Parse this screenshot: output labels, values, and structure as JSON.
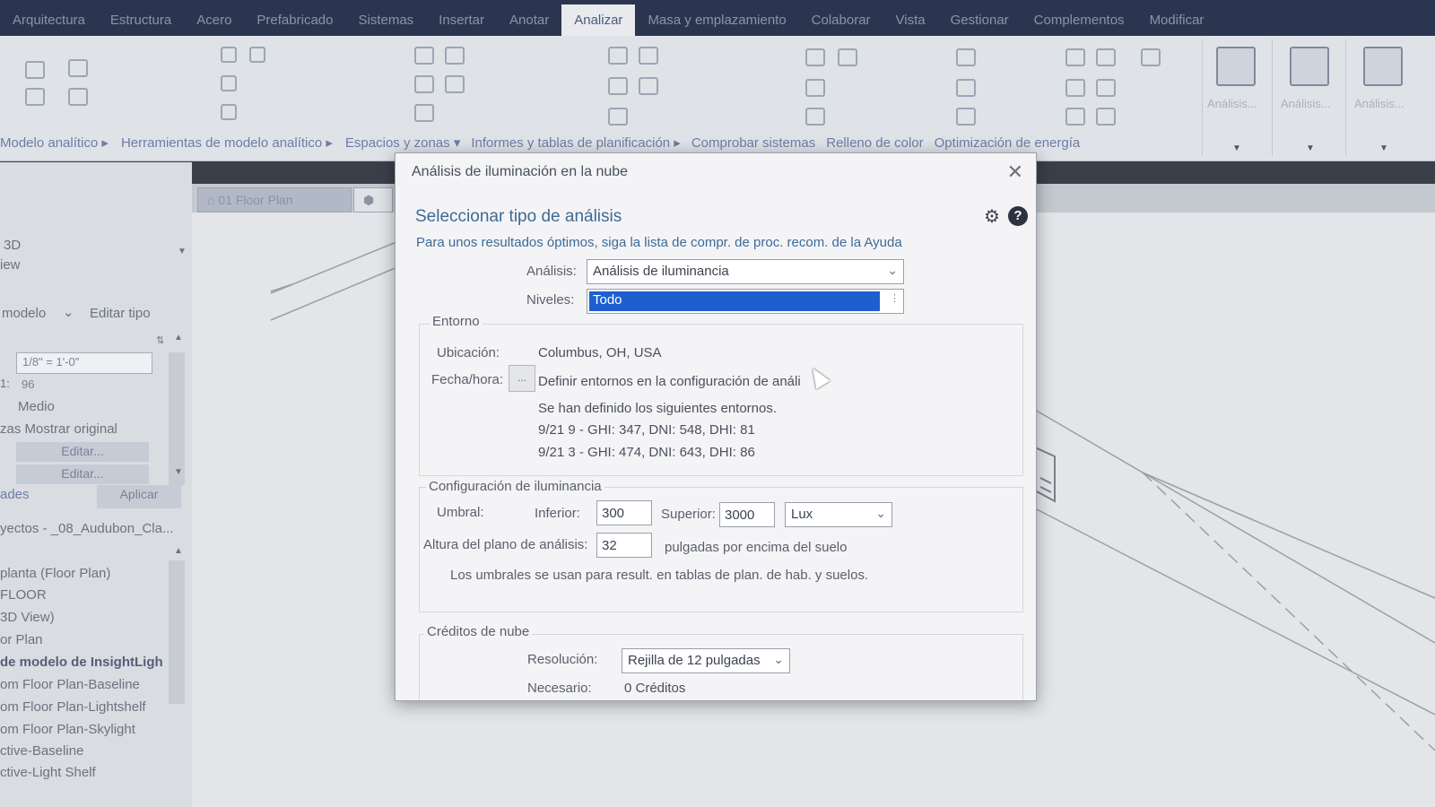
{
  "ribbon": {
    "tabs": [
      "Arquitectura",
      "Estructura",
      "Acero",
      "Prefabricado",
      "Sistemas",
      "Insertar",
      "Anotar",
      "Analizar",
      "Masa y emplazamiento",
      "Colaborar",
      "Vista",
      "Gestionar",
      "Complementos",
      "Modificar"
    ],
    "active_tab": "Analizar",
    "panels": [
      "Modelo analítico ▸",
      "Herramientas de modelo analítico ▸",
      "Espacios y zonas ▾",
      "Informes y tablas de planificación ▸",
      "Comprobar sistemas",
      "Relleno de color",
      "Optimización de energía"
    ],
    "big_buttons": [
      "Análisis...",
      "Análisis...",
      "Análisis..."
    ]
  },
  "left_panel": {
    "view_type_line1": "3D",
    "view_type_line2": "iew",
    "type_selector": "modelo",
    "edit_type": "Editar tipo",
    "scale_value": "1/8\" = 1'-0\"",
    "scale_number_label": "1:",
    "scale_number": "96",
    "detail_level": "Medio",
    "show_original": "zas Mostrar original",
    "edit1": "Editar...",
    "edit2": "Editar...",
    "help_link": "ades",
    "apply": "Aplicar",
    "project_title": "yectos - _08_Audubon_Cla...",
    "browser_items": [
      "planta (Floor Plan)",
      "FLOOR",
      "3D View)",
      "or Plan",
      "de modelo de InsightLigh",
      "om Floor Plan-Baseline",
      "om Floor Plan-Lightshelf",
      "om Floor Plan-Skylight",
      "ctive-Baseline",
      "ctive-Light Shelf"
    ]
  },
  "view_tabs": [
    "01 Floor Plan"
  ],
  "dialog": {
    "title": "Análisis de iluminación en la nube",
    "heading": "Seleccionar tipo de análisis",
    "hint": "Para unos resultados óptimos, siga la lista de compr. de proc. recom. de la Ayuda",
    "analysis_label": "Análisis:",
    "analysis_value": "Análisis de iluminancia",
    "levels_label": "Niveles:",
    "levels_value": "Todo",
    "environment": {
      "title": "Entorno",
      "location_label": "Ubicación:",
      "location_value": "Columbus, OH, USA",
      "datetime_label": "Fecha/hora:",
      "datetime_button": "...",
      "datetime_value": "Definir entornos en la configuración de análi",
      "defined_text": "Se han definido los siguientes entornos.",
      "env1": "9/21 9 - GHI: 347, DNI: 548, DHI: 81",
      "env2": "9/21 3 - GHI: 474, DNI: 643, DHI: 86"
    },
    "illuminance": {
      "title": "Configuración de iluminancia",
      "threshold_label": "Umbral:",
      "lower_label": "Inferior:",
      "lower_value": "300",
      "upper_label": "Superior:",
      "upper_value": "3000",
      "unit_value": "Lux",
      "plane_label": "Altura del plano de análisis:",
      "plane_value": "32",
      "plane_unit": "pulgadas por encima del suelo",
      "note": "Los umbrales se usan para result. en tablas de plan. de hab. y suelos."
    },
    "credits": {
      "title": "Créditos de nube",
      "resolution_label": "Resolución:",
      "resolution_value": "Rejilla de 12 pulgadas",
      "required_label": "Necesario:",
      "required_value": "0 Créditos"
    }
  }
}
